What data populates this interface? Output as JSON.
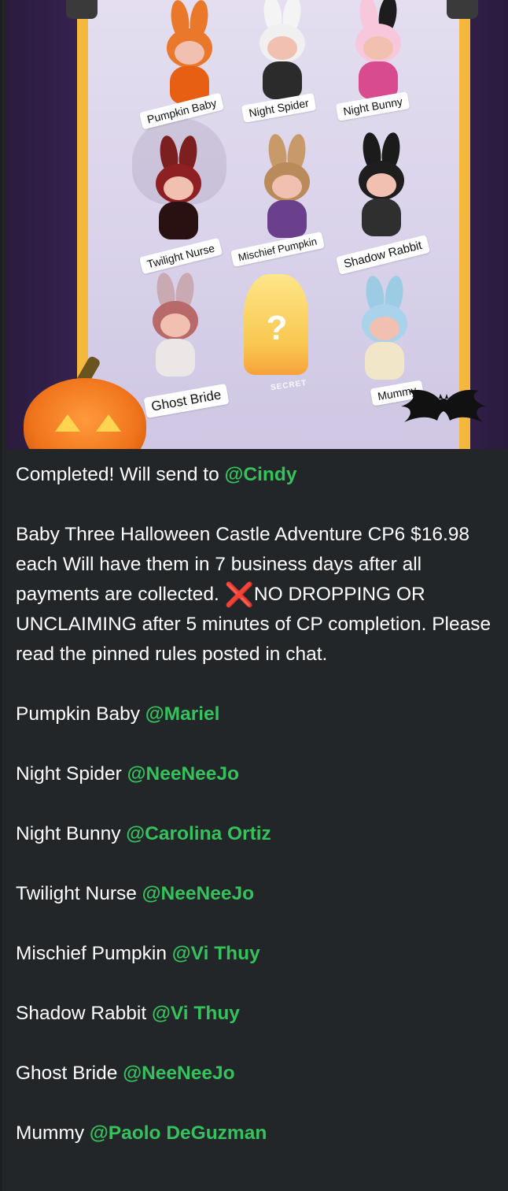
{
  "image": {
    "labels": {
      "pumpkin_baby": "Pumpkin Baby",
      "night_spider": "Night Spider",
      "night_bunny": "Night Bunny",
      "twilight_nurse": "Twilight Nurse",
      "mischief_pumpkin": "Mischief Pumpkin",
      "shadow_rabbit": "Shadow Rabbit",
      "ghost_bride": "Ghost Bride",
      "secret": "SECRET",
      "mummy": "Mummy",
      "secret_mark": "?"
    }
  },
  "message": {
    "line1_text": "Completed! Will send to ",
    "line1_mention": "@Cindy",
    "para_main_a": "Baby Three Halloween Castle Adventure CP6 $16.98 each Will have them in 7 business days after all payments are collected. ",
    "x_icon": "❌",
    "para_main_b": "NO DROPPING OR UNCLAIMING after 5 minutes of CP completion. Please read the pinned rules posted in chat.",
    "claims": [
      {
        "item": "Pumpkin Baby ",
        "mention": "@Mariel"
      },
      {
        "item": "Night Spider ",
        "mention": "@NeeNeeJo"
      },
      {
        "item": "Night Bunny ",
        "mention": "@Carolina Ortiz"
      },
      {
        "item": "Twilight Nurse ",
        "mention": "@NeeNeeJo"
      },
      {
        "item": "Mischief Pumpkin ",
        "mention": "@Vi Thuy"
      },
      {
        "item": "Shadow Rabbit ",
        "mention": "@Vi Thuy"
      },
      {
        "item": "Ghost Bride ",
        "mention": "@NeeNeeJo"
      },
      {
        "item": "Mummy ",
        "mention": "@Paolo DeGuzman"
      }
    ]
  },
  "colors": {
    "background": "#232628",
    "text": "#ffffff",
    "mention": "#35c25d",
    "x_mark": "#e23030"
  }
}
